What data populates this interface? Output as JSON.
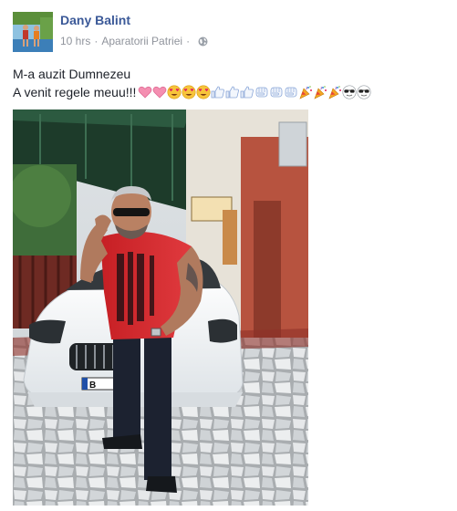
{
  "post": {
    "author": "Dany Balint",
    "time": "10 hrs",
    "separator": "·",
    "place": "Aparatorii Patriei",
    "audience_icon": "globe-icon",
    "text_line1": "M-a auzit Dumnezeu",
    "text_line2": "A venit regele meuu!!!",
    "emojis": [
      "heart-icon",
      "heart-icon",
      "heart-eyes-icon",
      "heart-eyes-icon",
      "heart-eyes-icon",
      "thumbs-up-icon",
      "thumbs-up-icon",
      "thumbs-up-icon",
      "fist-icon",
      "fist-icon",
      "fist-icon",
      "party-popper-icon",
      "party-popper-icon",
      "party-popper-icon",
      "sunglasses-icon",
      "sunglasses-icon"
    ],
    "plate_text": "B"
  },
  "colors": {
    "link_blue": "#3b5998",
    "meta_gray": "#90949c",
    "text_dark": "#1d2129",
    "shirt_red": "#d9262a",
    "car_white": "#f2f4f6"
  }
}
